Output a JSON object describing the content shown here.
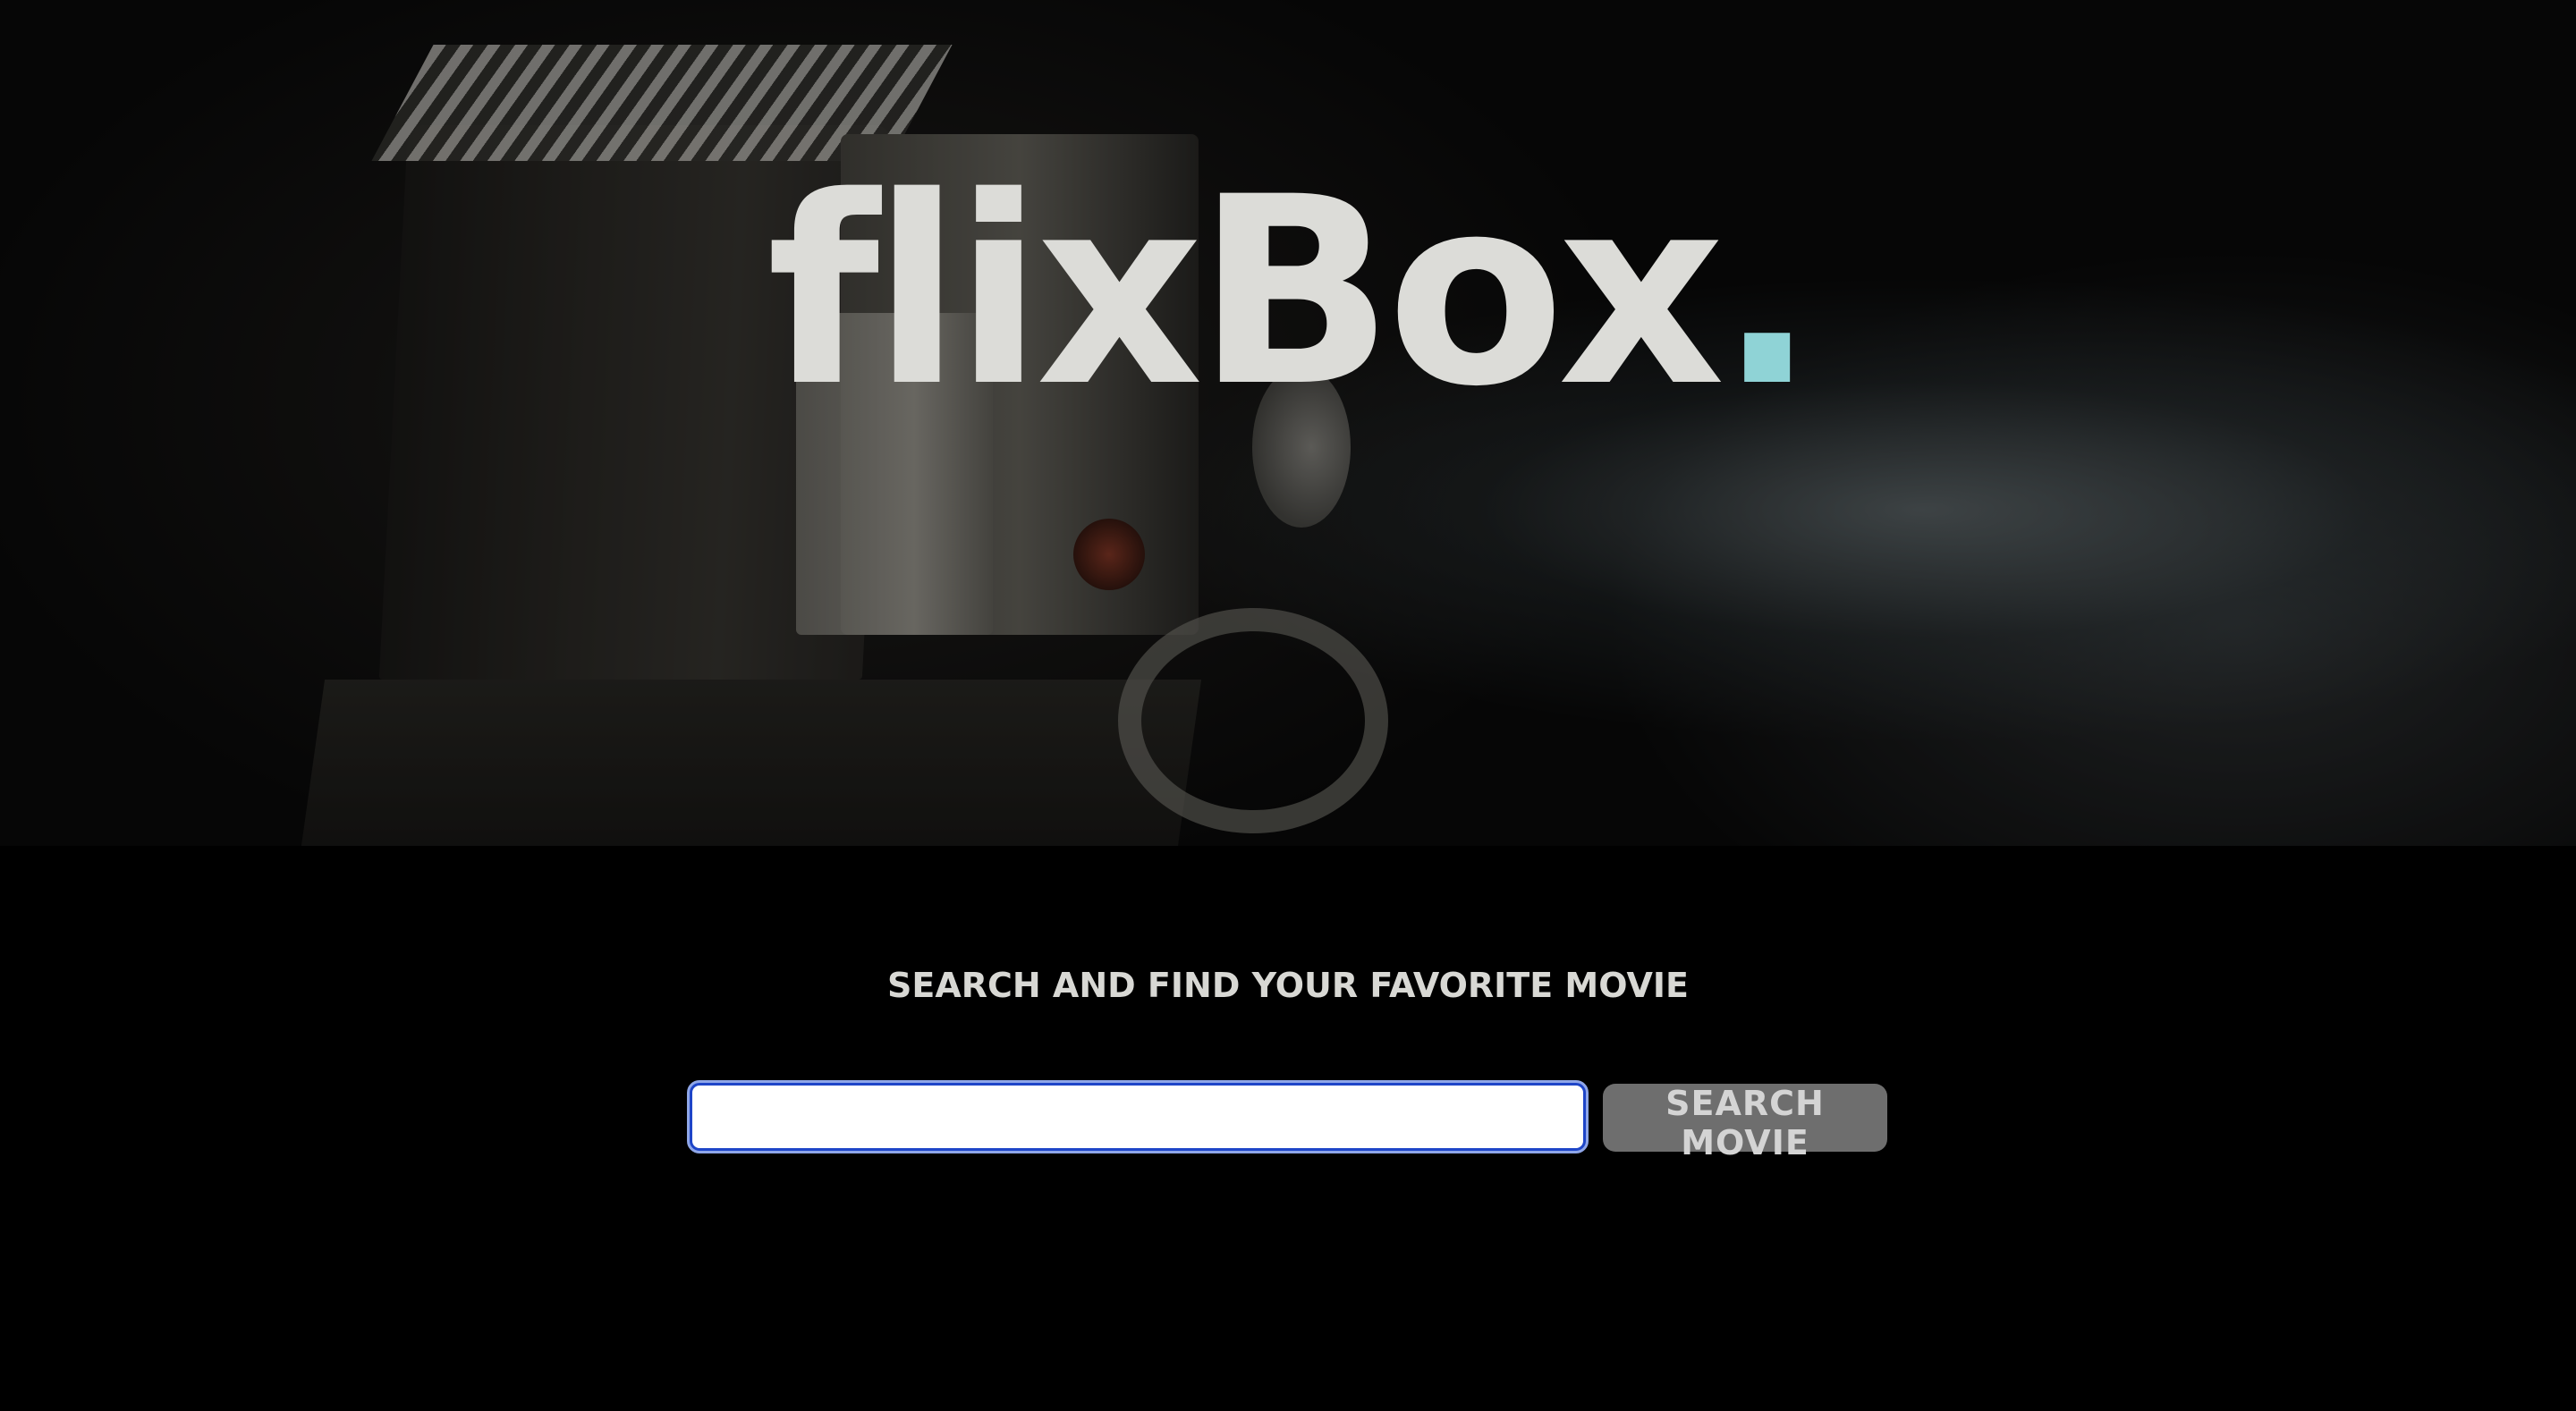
{
  "hero": {
    "logo_text": "flixBox",
    "logo_dot": "."
  },
  "main": {
    "tagline": "SEARCH AND FIND YOUR FAVORITE MOVIE",
    "search": {
      "value": "",
      "placeholder": "",
      "button_label": "SEARCH MOVIE"
    }
  },
  "colors": {
    "background": "#000000",
    "logo_text": "#dcdcd8",
    "logo_accent_dot": "#8fd3d6",
    "button_bg": "#6e6e6e",
    "input_focus_border": "#1e45c8"
  }
}
